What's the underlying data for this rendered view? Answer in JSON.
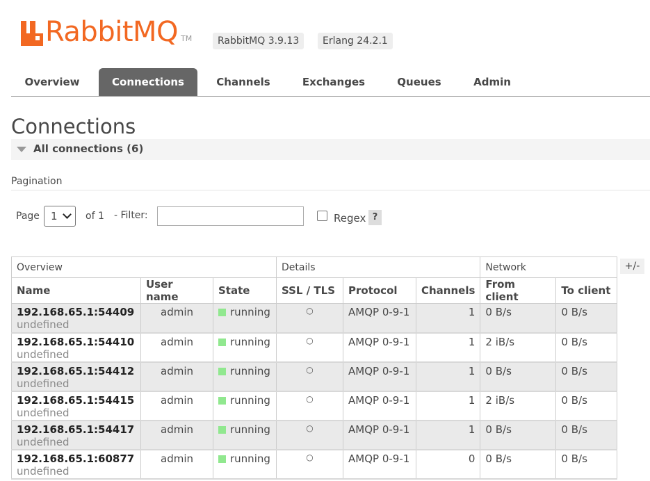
{
  "header": {
    "brand": "RabbitMQ",
    "brand_suffix": "MQ",
    "tm": "TM",
    "versions": [
      "RabbitMQ 3.9.13",
      "Erlang 24.2.1"
    ],
    "logo_color": "#f26822"
  },
  "tabs": [
    {
      "label": "Overview",
      "active": false
    },
    {
      "label": "Connections",
      "active": true
    },
    {
      "label": "Channels",
      "active": false
    },
    {
      "label": "Exchanges",
      "active": false
    },
    {
      "label": "Queues",
      "active": false
    },
    {
      "label": "Admin",
      "active": false
    }
  ],
  "page_title": "Connections",
  "section": {
    "label": "All connections (6)",
    "icon": "triangle-down-icon"
  },
  "pagination": {
    "label": "Pagination",
    "page_label": "Page",
    "page_value": "1",
    "of_label": "of 1",
    "filter_label": "- Filter:",
    "filter_value": "",
    "regex_label": "Regex",
    "regex_checked": false,
    "help_label": "?"
  },
  "table": {
    "groups": [
      "Overview",
      "Details",
      "Network"
    ],
    "columns": [
      "Name",
      "User name",
      "State",
      "SSL / TLS",
      "Protocol",
      "Channels",
      "From client",
      "To client"
    ],
    "plus_minus": "+/-",
    "rows": [
      {
        "name": "192.168.65.1:54409",
        "sub": "undefined",
        "user": "admin",
        "state": "running",
        "ssl": "○",
        "protocol": "AMQP 0-9-1",
        "channels": "1",
        "from": "0 B/s",
        "to": "0 B/s"
      },
      {
        "name": "192.168.65.1:54410",
        "sub": "undefined",
        "user": "admin",
        "state": "running",
        "ssl": "○",
        "protocol": "AMQP 0-9-1",
        "channels": "1",
        "from": "2 iB/s",
        "to": "0 B/s"
      },
      {
        "name": "192.168.65.1:54412",
        "sub": "undefined",
        "user": "admin",
        "state": "running",
        "ssl": "○",
        "protocol": "AMQP 0-9-1",
        "channels": "1",
        "from": "0 B/s",
        "to": "0 B/s"
      },
      {
        "name": "192.168.65.1:54415",
        "sub": "undefined",
        "user": "admin",
        "state": "running",
        "ssl": "○",
        "protocol": "AMQP 0-9-1",
        "channels": "1",
        "from": "2 iB/s",
        "to": "0 B/s"
      },
      {
        "name": "192.168.65.1:54417",
        "sub": "undefined",
        "user": "admin",
        "state": "running",
        "ssl": "○",
        "protocol": "AMQP 0-9-1",
        "channels": "1",
        "from": "0 B/s",
        "to": "0 B/s"
      },
      {
        "name": "192.168.65.1:60877",
        "sub": "undefined",
        "user": "admin",
        "state": "running",
        "ssl": "○",
        "protocol": "AMQP 0-9-1",
        "channels": "0",
        "from": "0 B/s",
        "to": "0 B/s"
      }
    ],
    "state_color": "#91e88f"
  }
}
